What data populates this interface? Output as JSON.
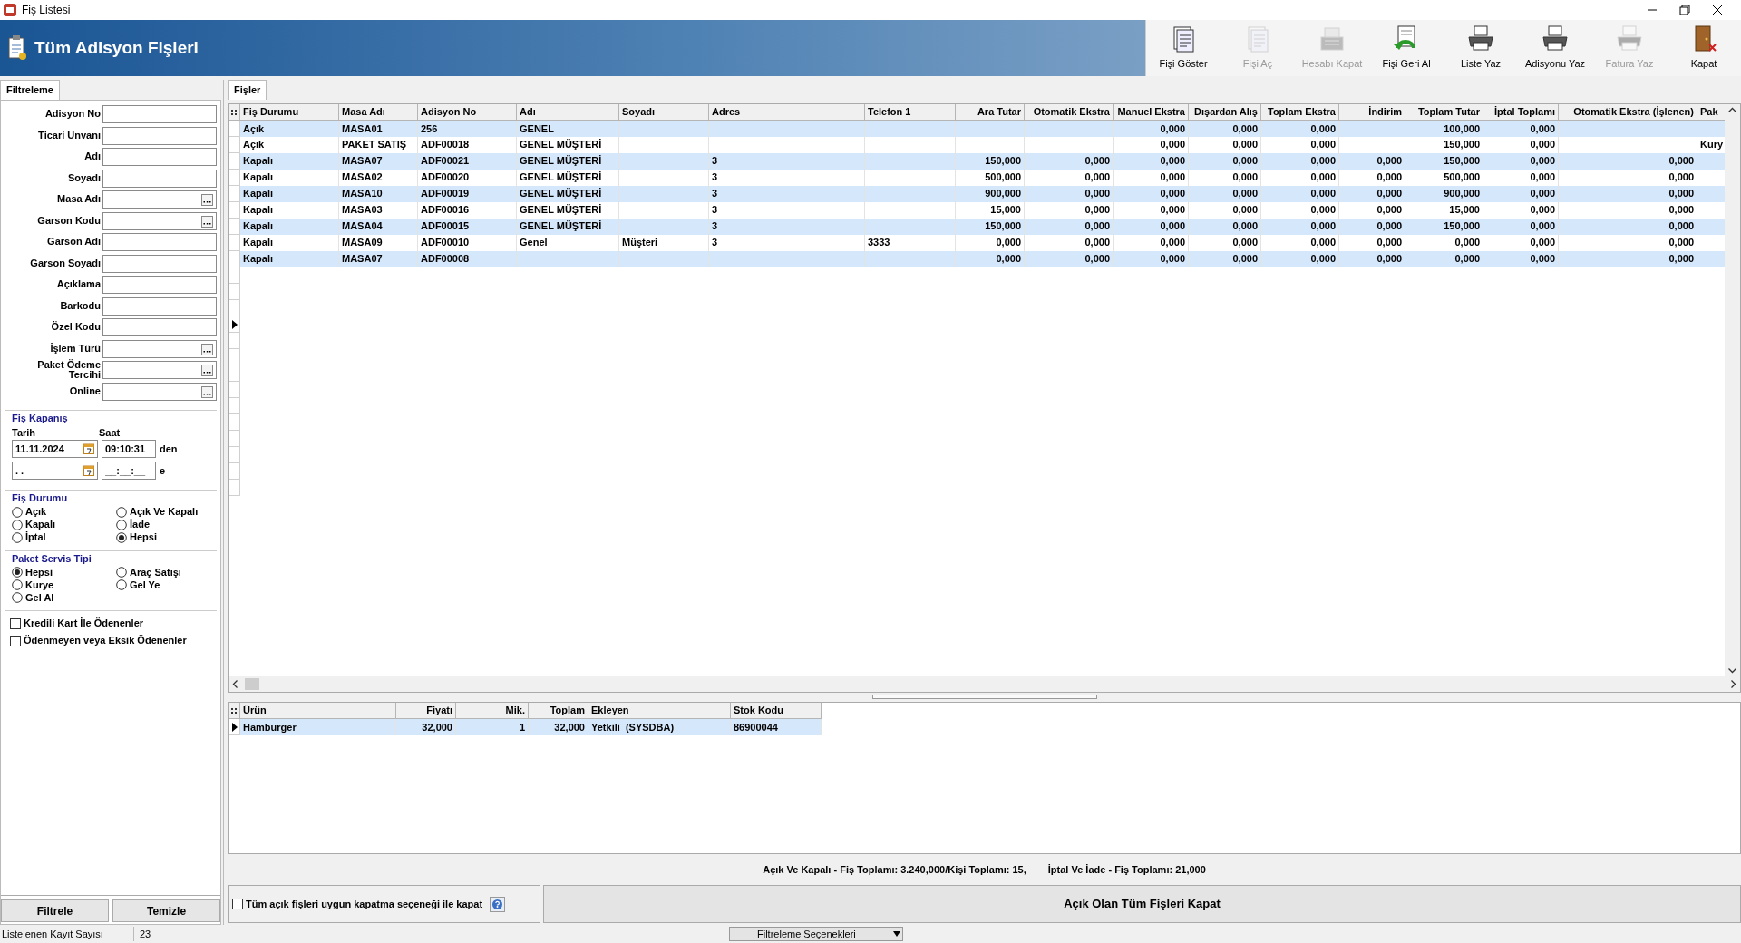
{
  "window": {
    "title": "Fiş Listesi"
  },
  "header": {
    "title": "Tüm Adisyon Fişleri"
  },
  "toolbar": [
    {
      "label": "Fişi Göster",
      "kind": "document",
      "disabled": false
    },
    {
      "label": "Fişi Aç",
      "kind": "document",
      "disabled": true
    },
    {
      "label": "Hesabı Kapat",
      "kind": "register",
      "disabled": true
    },
    {
      "label": "Fişi Geri Al",
      "kind": "undo",
      "disabled": false
    },
    {
      "label": "Liste Yaz",
      "kind": "printer",
      "disabled": false
    },
    {
      "label": "Adisyonu Yaz",
      "kind": "printer",
      "disabled": false
    },
    {
      "label": "Fatura Yaz",
      "kind": "printer",
      "disabled": true
    },
    {
      "label": "Kapat",
      "kind": "door",
      "disabled": false
    }
  ],
  "filter_panel": {
    "tab": "Filtreleme",
    "fields": [
      {
        "label": "Adisyon No",
        "lookup": false
      },
      {
        "label": "Ticari Unvanı",
        "lookup": false
      },
      {
        "label": "Adı",
        "lookup": false
      },
      {
        "label": "Soyadı",
        "lookup": false
      },
      {
        "label": "Masa Adı",
        "lookup": true
      },
      {
        "label": "Garson Kodu",
        "lookup": true
      },
      {
        "label": "Garson Adı",
        "lookup": false
      },
      {
        "label": "Garson Soyadı",
        "lookup": false
      },
      {
        "label": "Açıklama",
        "lookup": false
      },
      {
        "label": "Barkodu",
        "lookup": false
      },
      {
        "label": "Özel Kodu",
        "lookup": false
      },
      {
        "label": "İşlem Türü",
        "lookup": true
      },
      {
        "label": "Paket Ödeme Tercihi",
        "lookup": true
      },
      {
        "label": "Online",
        "lookup": true
      }
    ],
    "closing": {
      "title": "Fiş Kapanış",
      "date_label": "Tarih",
      "time_label": "Saat",
      "rows": [
        {
          "date": "11.11.2024",
          "time": "09:10:31",
          "suffix": "den"
        },
        {
          "date": ". .",
          "time": "__:__:__",
          "suffix": "e"
        }
      ]
    },
    "status_group": {
      "title": "Fiş Durumu",
      "options": [
        {
          "label": "Açık",
          "selected": false
        },
        {
          "label": "Açık Ve Kapalı",
          "selected": false
        },
        {
          "label": "Kapalı",
          "selected": false
        },
        {
          "label": "İade",
          "selected": false
        },
        {
          "label": "İptal",
          "selected": false
        },
        {
          "label": "Hepsi",
          "selected": true
        }
      ]
    },
    "service_group": {
      "title": "Paket Servis Tipi",
      "options": [
        {
          "label": "Hepsi",
          "selected": true
        },
        {
          "label": "Araç Satışı",
          "selected": false
        },
        {
          "label": "Kurye",
          "selected": false
        },
        {
          "label": "Gel Ye",
          "selected": false
        },
        {
          "label": "Gel Al",
          "selected": false
        }
      ]
    },
    "checkboxes": [
      {
        "label": "Kredili Kart İle Ödenenler",
        "checked": false
      },
      {
        "label": "Ödenmeyen veya Eksik Ödenenler",
        "checked": false
      }
    ],
    "buttons": [
      "Filtrele",
      "Temizle"
    ]
  },
  "receipts": {
    "tab": "Fişler",
    "columns": [
      {
        "label": "Fiş Durumu",
        "kind": "text"
      },
      {
        "label": "Masa Adı",
        "kind": "text"
      },
      {
        "label": "Adisyon No",
        "kind": "text"
      },
      {
        "label": "Adı",
        "kind": "text"
      },
      {
        "label": "Soyadı",
        "kind": "text"
      },
      {
        "label": "Adres",
        "kind": "text"
      },
      {
        "label": "Telefon 1",
        "kind": "text"
      },
      {
        "label": "Ara Tutar",
        "kind": "number"
      },
      {
        "label": "Otomatik Ekstra",
        "kind": "number"
      },
      {
        "label": "Manuel Ekstra",
        "kind": "number"
      },
      {
        "label": "Dışardan Alış",
        "kind": "number"
      },
      {
        "label": "Toplam Ekstra",
        "kind": "number"
      },
      {
        "label": "İndirim",
        "kind": "number"
      },
      {
        "label": "Toplam Tutar",
        "kind": "number"
      },
      {
        "label": "İptal Toplamı",
        "kind": "number"
      },
      {
        "label": "Otomatik Ekstra (İşlenen)",
        "kind": "number"
      },
      {
        "label": "Pak",
        "kind": "text"
      }
    ],
    "rows": [
      [
        "Açık",
        "MASA01",
        "256",
        "GENEL",
        null,
        null,
        null,
        null,
        null,
        "0,000",
        "0,000",
        "0,000",
        null,
        "100,000",
        "0,000",
        null,
        null
      ],
      [
        "Açık",
        "PAKET SATIŞ",
        "ADF00018",
        "GENEL MÜŞTERİ",
        null,
        null,
        null,
        null,
        null,
        "0,000",
        "0,000",
        "0,000",
        null,
        "150,000",
        "0,000",
        null,
        "Kury"
      ],
      [
        "Kapalı",
        "MASA07",
        "ADF00021",
        "GENEL MÜŞTERİ",
        null,
        "3",
        null,
        "150,000",
        "0,000",
        "0,000",
        "0,000",
        "0,000",
        "0,000",
        "150,000",
        "0,000",
        "0,000",
        null
      ],
      [
        "Kapalı",
        "MASA02",
        "ADF00020",
        "GENEL MÜŞTERİ",
        null,
        "3",
        null,
        "500,000",
        "0,000",
        "0,000",
        "0,000",
        "0,000",
        "0,000",
        "500,000",
        "0,000",
        "0,000",
        null
      ],
      [
        "Kapalı",
        "MASA10",
        "ADF00019",
        "GENEL MÜŞTERİ",
        null,
        "3",
        null,
        "900,000",
        "0,000",
        "0,000",
        "0,000",
        "0,000",
        "0,000",
        "900,000",
        "0,000",
        "0,000",
        null
      ],
      [
        "Kapalı",
        "MASA03",
        "ADF00016",
        "GENEL MÜŞTERİ",
        null,
        "3",
        null,
        "15,000",
        "0,000",
        "0,000",
        "0,000",
        "0,000",
        "0,000",
        "15,000",
        "0,000",
        "0,000",
        null
      ],
      [
        "Kapalı",
        "MASA04",
        "ADF00015",
        "GENEL MÜŞTERİ",
        null,
        "3",
        null,
        "150,000",
        "0,000",
        "0,000",
        "0,000",
        "0,000",
        "0,000",
        "150,000",
        "0,000",
        "0,000",
        null
      ],
      [
        "Kapalı",
        "MASA09",
        "ADF00010",
        "Genel",
        "Müşteri",
        "3",
        "3333",
        "0,000",
        "0,000",
        "0,000",
        "0,000",
        "0,000",
        "0,000",
        "0,000",
        "0,000",
        "0,000",
        null
      ],
      [
        "Kapalı",
        "MASA07",
        "ADF00008",
        null,
        null,
        null,
        null,
        "0,000",
        "0,000",
        "0,000",
        "0,000",
        "0,000",
        "0,000",
        "0,000",
        "0,000",
        "0,000",
        null
      ]
    ],
    "blank_rows": [
      {
        "current": false
      },
      {
        "current": false
      },
      {
        "current": false
      },
      {
        "current": true
      },
      {
        "current": false
      },
      {
        "current": false
      },
      {
        "current": false
      },
      {
        "current": false
      },
      {
        "current": false
      },
      {
        "current": false
      },
      {
        "current": false
      },
      {
        "current": false
      },
      {
        "current": false
      },
      {
        "current": false
      }
    ]
  },
  "items": {
    "columns": [
      {
        "label": "Ürün",
        "kind": "text"
      },
      {
        "label": "Fiyatı",
        "kind": "number"
      },
      {
        "label": "Mik.",
        "kind": "number"
      },
      {
        "label": "Toplam",
        "kind": "number"
      },
      {
        "label": "Ekleyen",
        "kind": "text"
      },
      {
        "label": "Stok Kodu",
        "kind": "text"
      }
    ],
    "rows": [
      {
        "cells": [
          "Hamburger",
          "32,000",
          "1",
          "32,000",
          "Yetkili  (SYSDBA)",
          "86900044"
        ],
        "current": true
      }
    ]
  },
  "summary": [
    "Açık Ve Kapalı - Fiş Toplamı: 3.240,000/Kişi Toplamı: 15,",
    "İptal Ve İade - Fiş Toplamı: 21,000"
  ],
  "close_option": {
    "label": "Tüm açık fişleri uygun kapatma seçeneği ile kapat",
    "checked": false
  },
  "close_all_button": "Açık Olan Tüm Fişleri Kapat",
  "status_bar": {
    "label": "Listelenen Kayıt Sayısı",
    "count": "23",
    "menu": "Filtreleme Seçenekleri"
  }
}
